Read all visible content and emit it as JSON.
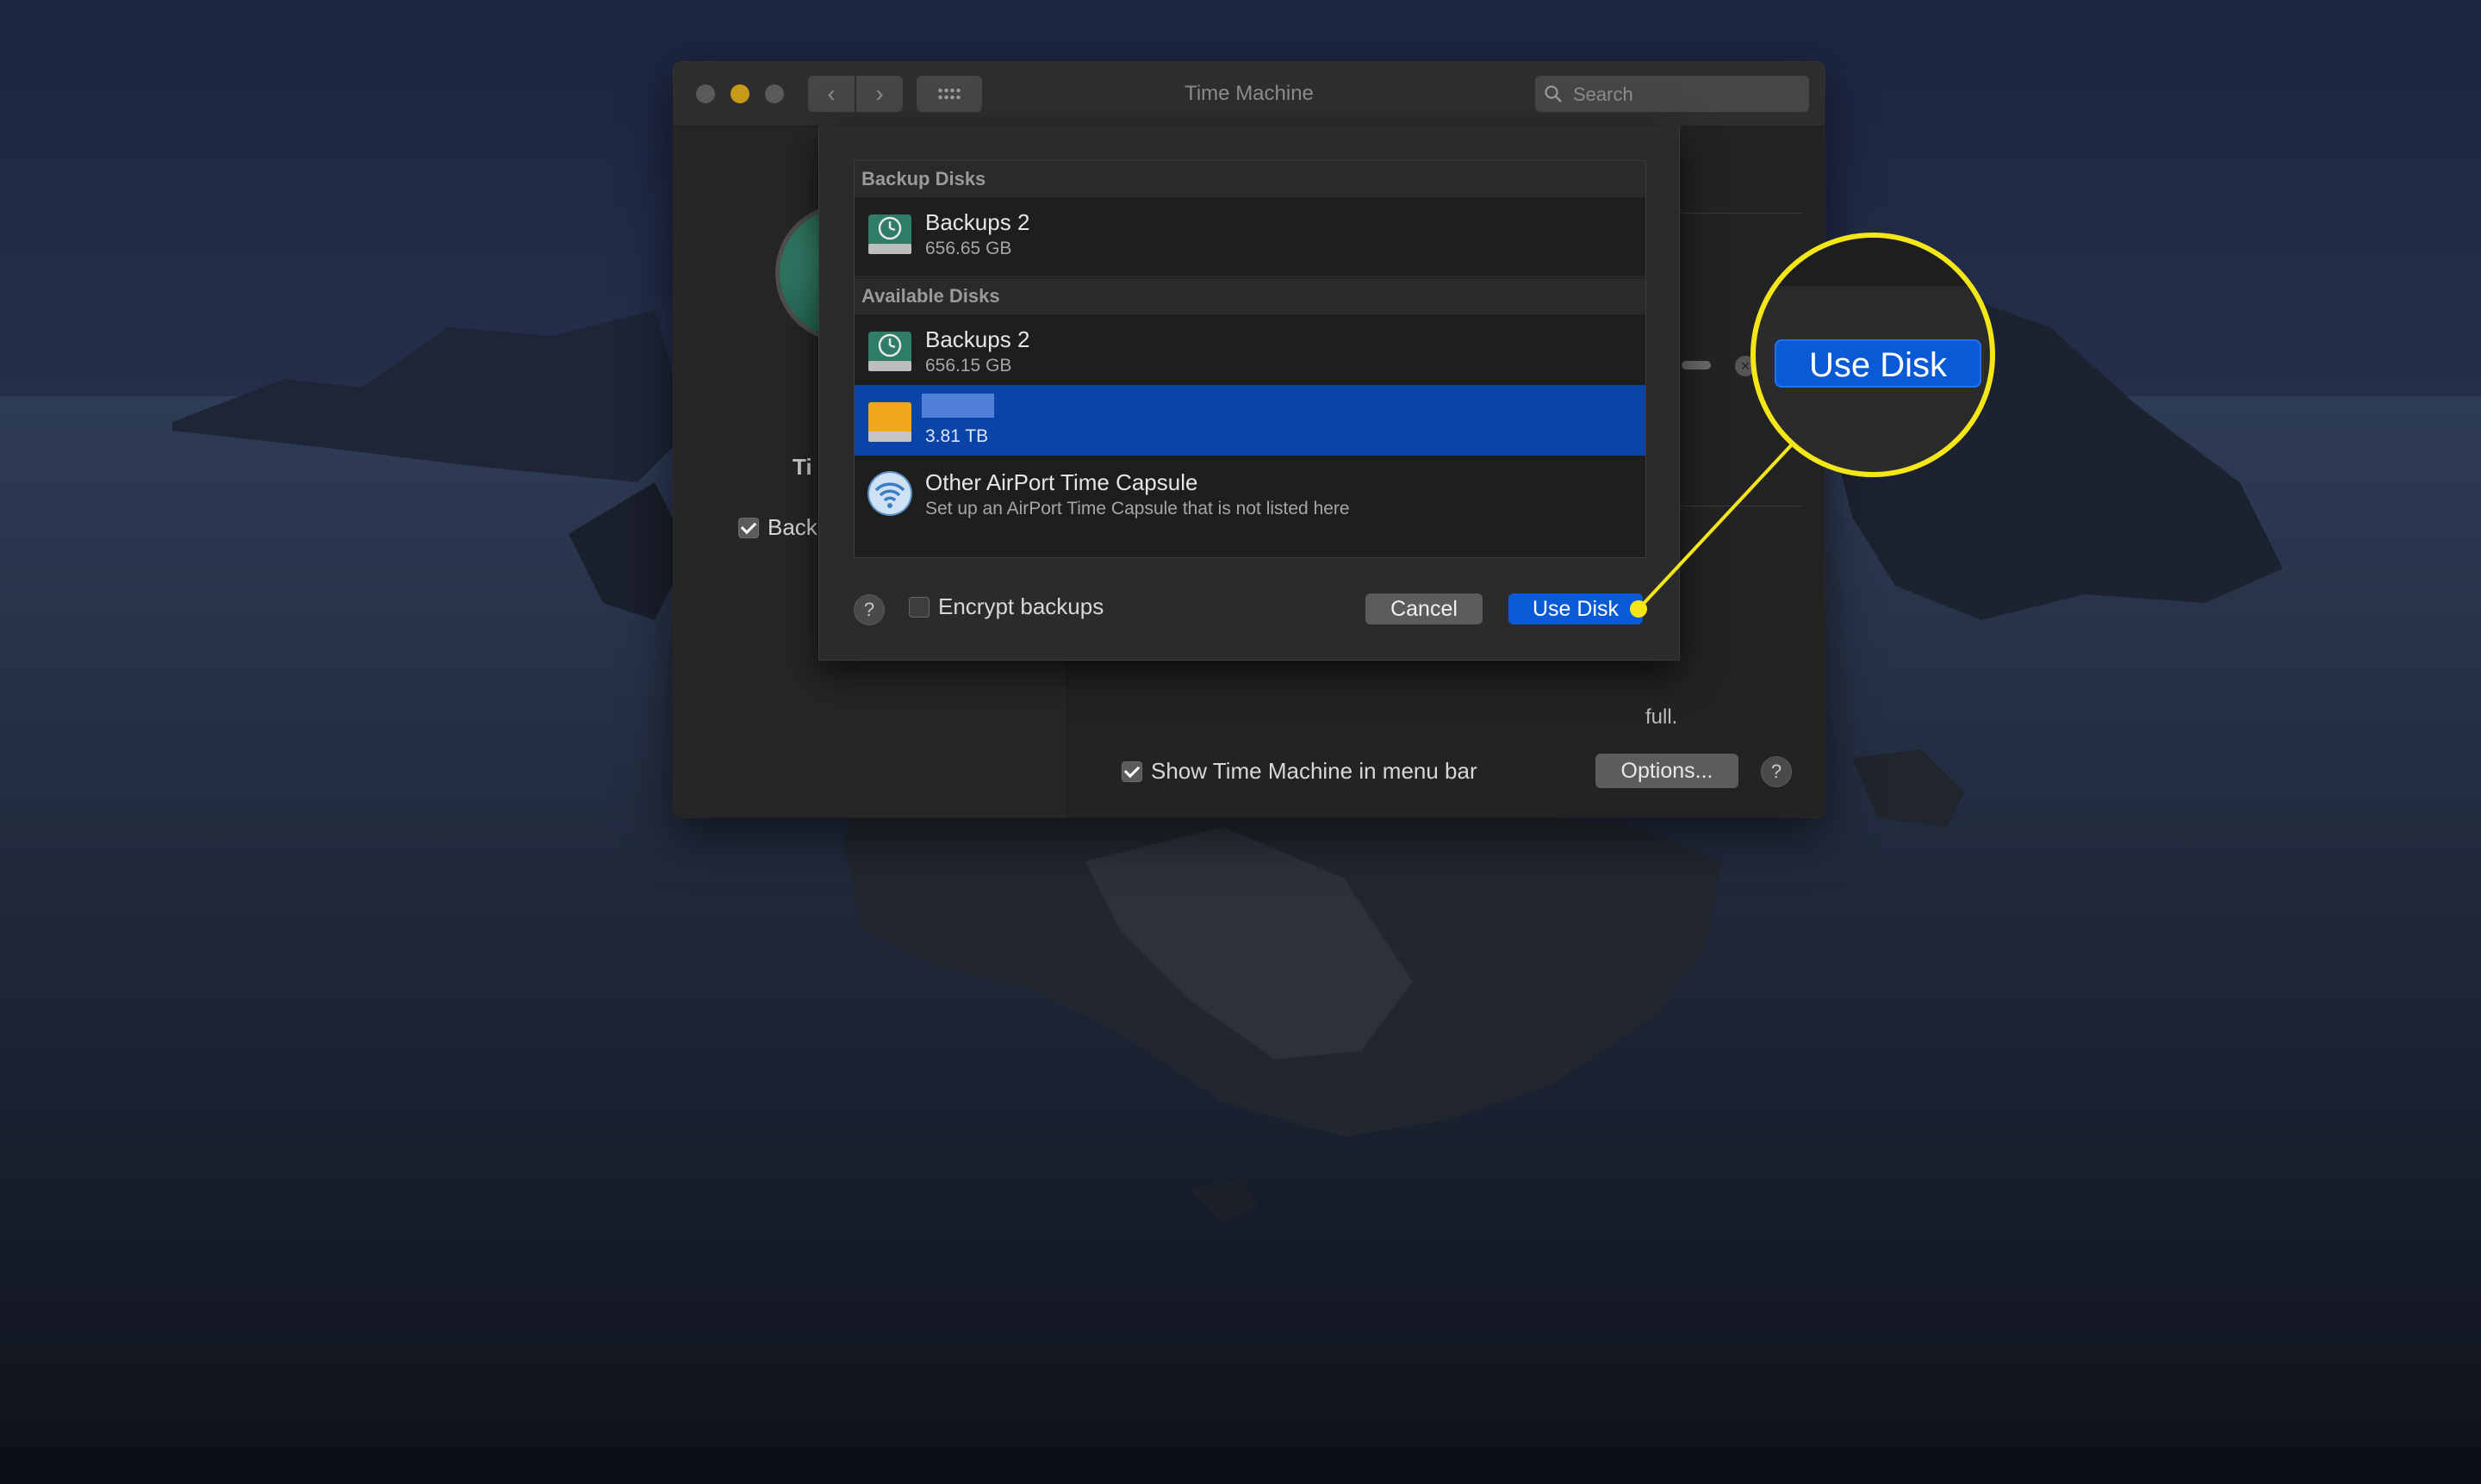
{
  "window": {
    "title": "Time Machine",
    "search_placeholder": "Search"
  },
  "left_pane": {
    "app_label_partial": "Ti",
    "backup_checkbox_label_partial": "Back"
  },
  "right_pane": {
    "partial_text_full": "full.",
    "show_menu_bar_label": "Show Time Machine in menu bar",
    "options_label": "Options...",
    "help_label": "?"
  },
  "sheet": {
    "backup_disks_header": "Backup Disks",
    "backup_disks": [
      {
        "name": "Backups 2",
        "size": "656.65 GB",
        "icon": "time-machine-disk-icon"
      }
    ],
    "available_disks_header": "Available Disks",
    "available_disks": [
      {
        "name": "Backups 2",
        "size": "656.15 GB",
        "icon": "time-machine-disk-icon"
      },
      {
        "name": "",
        "size": "3.81 TB",
        "icon": "external-drive-icon",
        "selected": true
      },
      {
        "name": "Other AirPort Time Capsule",
        "size": "Set up an AirPort Time Capsule that is not listed here",
        "icon": "wifi-icon"
      }
    ],
    "help_label": "?",
    "encrypt_label": "Encrypt backups",
    "cancel_label": "Cancel",
    "use_disk_label": "Use Disk"
  },
  "callout": {
    "zoom_label": "Use Disk",
    "color": "#f5e717"
  },
  "colors": {
    "selection": "#0a44a8",
    "primary_button": "#0a5ad6",
    "traffic_minimize": "#c79a1a"
  }
}
